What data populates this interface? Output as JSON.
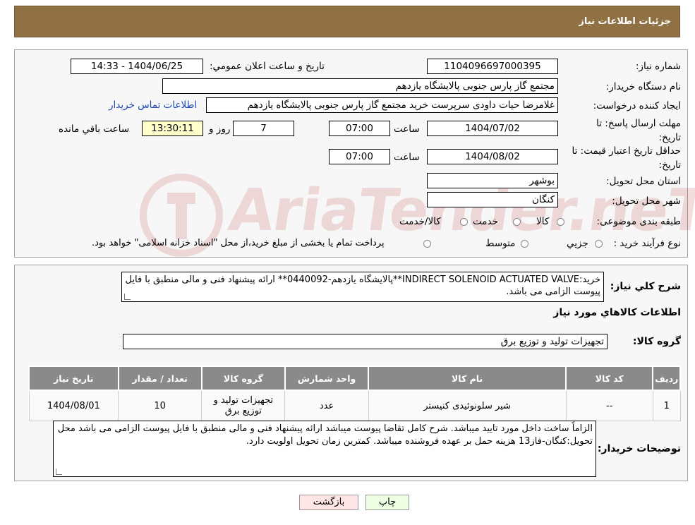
{
  "header": {
    "title": "جزئیات اطلاعات نیاز"
  },
  "form": {
    "need_number_label": "شماره نیاز:",
    "need_number": "1104096697000395",
    "announce_label": "تاریخ و ساعت اعلان عمومي:",
    "announce_value": "1404/06/25 - 14:33",
    "buyer_org_label": "نام دستگاه خریدار:",
    "buyer_org": "مجتمع گاز پارس جنوبی  پالایشگاه یازدهم",
    "creator_label": "ایجاد کننده درخواست:",
    "creator": "غلامرضا حیات داودی سرپرست خرید مجتمع گاز پارس جنوبی  پالایشگاه یازدهم",
    "buyer_contact_link": "اطلاعات تماس خریدار",
    "reply_deadline_label": "مهلت ارسال پاسخ: تا تاریخ:",
    "reply_date": "1404/07/02",
    "time_label": "ساعت",
    "reply_time": "07:00",
    "days_value": "7",
    "days_label": "روز و",
    "remaining_time": "13:30:11",
    "remaining_label": "ساعت باقي مانده",
    "price_validity_label": "حداقل تاریخ اعتبار قیمت: تا تاریخ:",
    "validity_date": "1404/08/02",
    "validity_time": "07:00",
    "province_label": "استان محل تحویل:",
    "province": "بوشهر",
    "city_label": "شهر محل تحویل:",
    "city": "کنگان",
    "category_label": "طبقه بندی موضوعی:",
    "category_options": [
      "کالا",
      "خدمت",
      "کالا/خدمت"
    ],
    "process_label": "نوع فرآیند خرید :",
    "process_options": [
      "جزيي",
      "متوسط"
    ],
    "process_note": "پرداخت تمام یا بخشی از مبلغ خرید،از محل \"اسناد خزانه اسلامی\" خواهد بود."
  },
  "watermark": {
    "text": "AriaTender.neT"
  },
  "summary": {
    "label": "شرح كلي نياز:",
    "text": "خرید:INDIRECT SOLENOID ACTUATED VALVE**پالایشگاه یازدهم-0440092** ارائه پیشنهاد فنی و مالی منطبق با فایل پیوست الزامی می باشد.",
    "items_heading": "اطلاعات كالاهاي مورد نياز",
    "group_label": "گروه کالا:",
    "group_value": "تجهیزات تولید و توزیع برق"
  },
  "table": {
    "headers": [
      "رديف",
      "کد کالا",
      "نام کالا",
      "واحد شمارش",
      "گروه کالا",
      "تعداد / مقدار",
      "تاریخ نیاز"
    ],
    "rows": [
      [
        "1",
        "--",
        "شیر سلونوئیدی کنیستر",
        "عدد",
        "تجهیزات تولید و توزیع برق",
        "10",
        "1404/08/01"
      ]
    ]
  },
  "notes": {
    "label": "توضیحات خریدار:",
    "text": "الزاماً ساخت داخل مورد تایید میباشد. شرح کامل تقاضا پیوست میباشد ارائه پیشنهاد فنی و مالی منطبق با فایل پیوست الزامی می باشد محل تحویل:کنگان-فاز13 هزینه حمل بر عهده فروشنده میباشد. کمترین زمان تحویل اولویت دارد."
  },
  "buttons": {
    "print": "چاپ",
    "back": "بازگشت"
  },
  "colors": {
    "header_bg": "#8f7144",
    "table_header_bg": "#8a8a8a",
    "remaining_bg": "#ffffcc",
    "print_bg": "#efffe4",
    "back_bg": "#ffe6e6"
  }
}
